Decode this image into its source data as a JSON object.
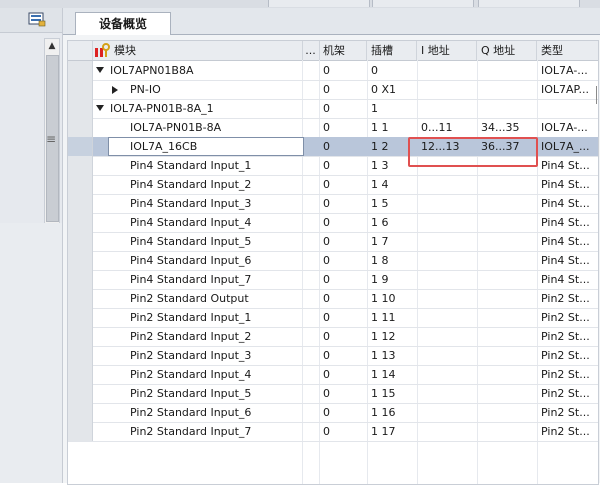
{
  "tab": {
    "label": "设备概览"
  },
  "columns": {
    "module": "模块",
    "dots": "...",
    "rack": "机架",
    "slot": "插槽",
    "i_addr": "I 地址",
    "q_addr": "Q 地址",
    "type": "类型"
  },
  "rows": [
    {
      "indent": 0,
      "expander": "down",
      "module": "IOL7APN01B8A",
      "rack": "0",
      "slot": "0",
      "i": "",
      "q": "",
      "type": "IOL7A-..."
    },
    {
      "indent": 1,
      "expander": "right",
      "module": "PN-IO",
      "rack": "0",
      "slot": "0 X1",
      "i": "",
      "q": "",
      "type": "IOL7AP..."
    },
    {
      "indent": 0,
      "expander": "down",
      "module": "IOL7A-PN01B-8A_1",
      "rack": "0",
      "slot": "1",
      "i": "",
      "q": "",
      "type": ""
    },
    {
      "indent": 1,
      "expander": "",
      "module": "IOL7A-PN01B-8A",
      "rack": "0",
      "slot": "1 1",
      "i": "0...11",
      "q": "34...35",
      "type": "IOL7A-..."
    },
    {
      "indent": 1,
      "expander": "",
      "module": "IOL7A_16CB",
      "rack": "0",
      "slot": "1 2",
      "i": "12...13",
      "q": "36...37",
      "type": "IOL7A_...",
      "selected": true
    },
    {
      "indent": 1,
      "expander": "",
      "module": "Pin4 Standard Input_1",
      "rack": "0",
      "slot": "1 3",
      "i": "",
      "q": "",
      "type": "Pin4 St..."
    },
    {
      "indent": 1,
      "expander": "",
      "module": "Pin4 Standard Input_2",
      "rack": "0",
      "slot": "1 4",
      "i": "",
      "q": "",
      "type": "Pin4 St..."
    },
    {
      "indent": 1,
      "expander": "",
      "module": "Pin4 Standard Input_3",
      "rack": "0",
      "slot": "1 5",
      "i": "",
      "q": "",
      "type": "Pin4 St..."
    },
    {
      "indent": 1,
      "expander": "",
      "module": "Pin4 Standard Input_4",
      "rack": "0",
      "slot": "1 6",
      "i": "",
      "q": "",
      "type": "Pin4 St..."
    },
    {
      "indent": 1,
      "expander": "",
      "module": "Pin4 Standard Input_5",
      "rack": "0",
      "slot": "1 7",
      "i": "",
      "q": "",
      "type": "Pin4 St..."
    },
    {
      "indent": 1,
      "expander": "",
      "module": "Pin4 Standard Input_6",
      "rack": "0",
      "slot": "1 8",
      "i": "",
      "q": "",
      "type": "Pin4 St..."
    },
    {
      "indent": 1,
      "expander": "",
      "module": "Pin4 Standard Input_7",
      "rack": "0",
      "slot": "1 9",
      "i": "",
      "q": "",
      "type": "Pin4 St..."
    },
    {
      "indent": 1,
      "expander": "",
      "module": "Pin2 Standard Output",
      "rack": "0",
      "slot": "1 10",
      "i": "",
      "q": "",
      "type": "Pin2 St..."
    },
    {
      "indent": 1,
      "expander": "",
      "module": "Pin2 Standard Input_1",
      "rack": "0",
      "slot": "1 11",
      "i": "",
      "q": "",
      "type": "Pin2 St..."
    },
    {
      "indent": 1,
      "expander": "",
      "module": "Pin2 Standard Input_2",
      "rack": "0",
      "slot": "1 12",
      "i": "",
      "q": "",
      "type": "Pin2 St..."
    },
    {
      "indent": 1,
      "expander": "",
      "module": "Pin2 Standard Input_3",
      "rack": "0",
      "slot": "1 13",
      "i": "",
      "q": "",
      "type": "Pin2 St..."
    },
    {
      "indent": 1,
      "expander": "",
      "module": "Pin2 Standard Input_4",
      "rack": "0",
      "slot": "1 14",
      "i": "",
      "q": "",
      "type": "Pin2 St..."
    },
    {
      "indent": 1,
      "expander": "",
      "module": "Pin2 Standard Input_5",
      "rack": "0",
      "slot": "1 15",
      "i": "",
      "q": "",
      "type": "Pin2 St..."
    },
    {
      "indent": 1,
      "expander": "",
      "module": "Pin2 Standard Input_6",
      "rack": "0",
      "slot": "1 16",
      "i": "",
      "q": "",
      "type": "Pin2 St..."
    },
    {
      "indent": 1,
      "expander": "",
      "module": "Pin2 Standard Input_7",
      "rack": "0",
      "slot": "1 17",
      "i": "",
      "q": "",
      "type": "Pin2 St..."
    }
  ],
  "colors": {
    "selection": "#b9c6da",
    "highlight_box": "#e05050"
  },
  "icons": {
    "header_module": "wrench-module-icon",
    "overview": "device-overview-icon"
  }
}
